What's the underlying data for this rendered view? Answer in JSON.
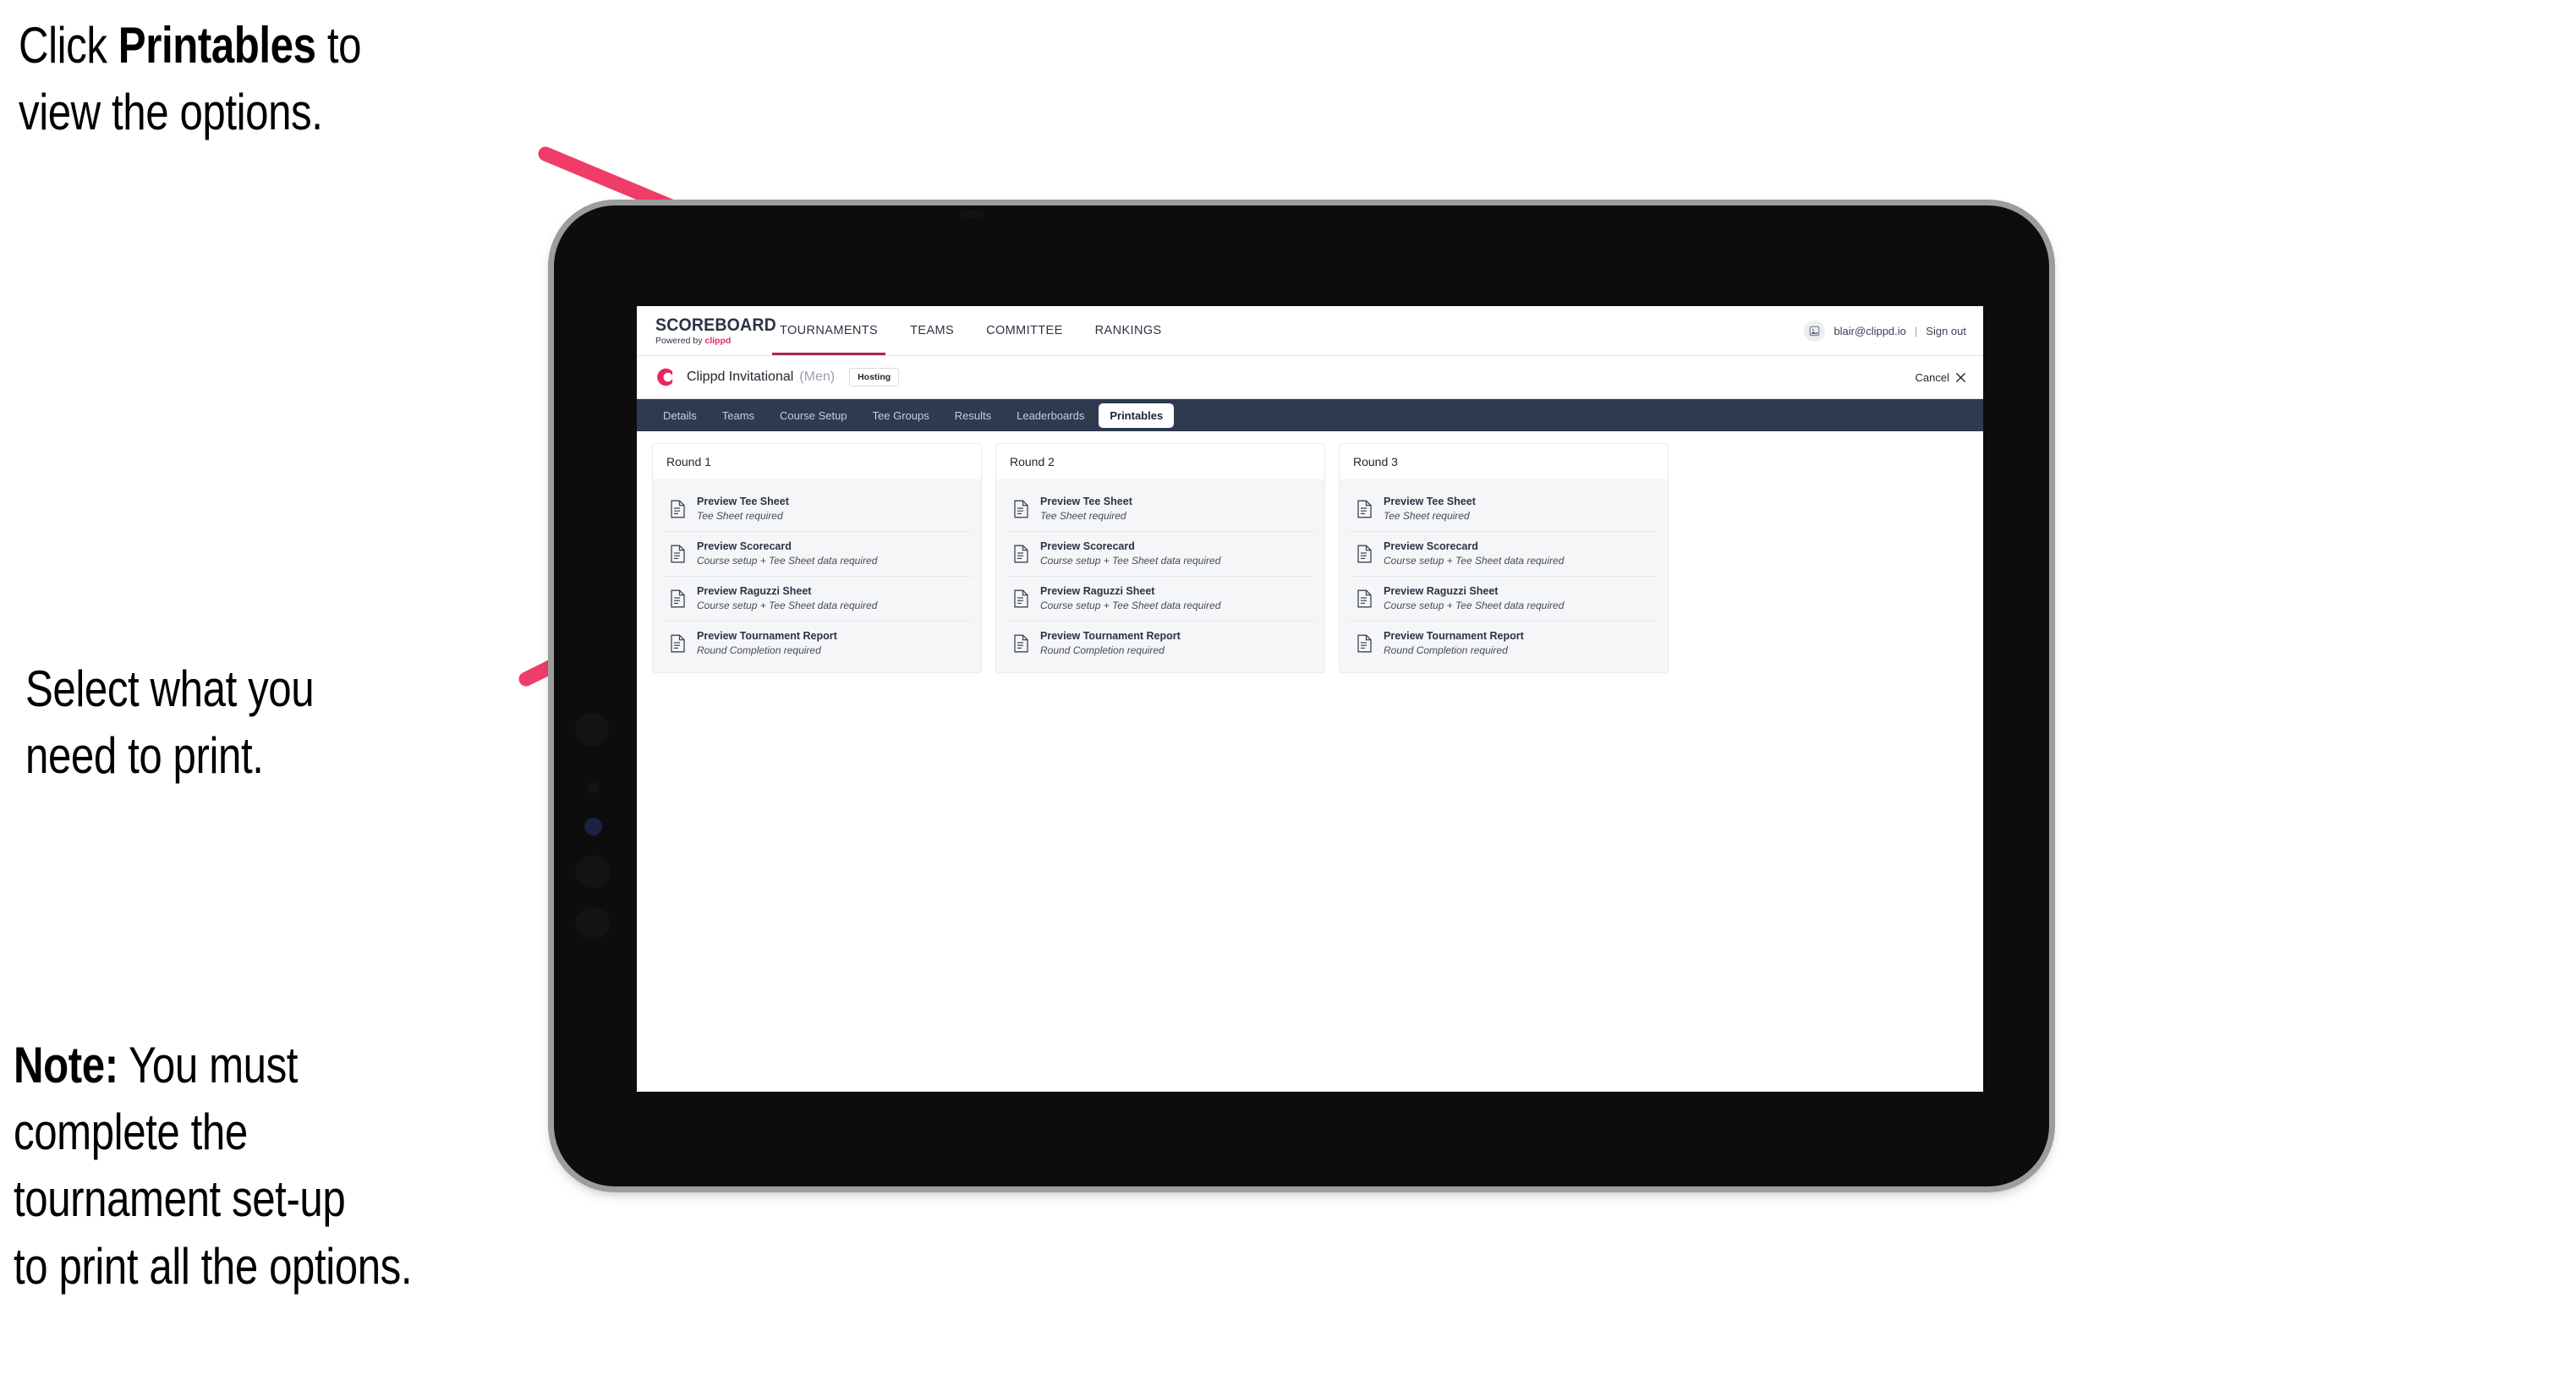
{
  "annotations": {
    "click_printables": "Click **Printables** to\nview the options.",
    "click_printables_pre": "Click ",
    "click_printables_bold": "Printables",
    "click_printables_post": " to\nview the options.",
    "select_print": "Select what you\n need to print.",
    "note_label": "Note:",
    "note_body": " You must\ncomplete the\ntournament set-up\nto print all the options.",
    "arrow_color": "#ef3d68"
  },
  "topbar": {
    "logo_word": "SCOREBOARD",
    "logo_sub_prefix": "Powered by ",
    "logo_sub_brand": "clippd",
    "nav": [
      {
        "label": "TOURNAMENTS",
        "active": true
      },
      {
        "label": "TEAMS",
        "active": false
      },
      {
        "label": "COMMITTEE",
        "active": false
      },
      {
        "label": "RANKINGS",
        "active": false
      }
    ],
    "avatar_icon": "user-avatar-icon",
    "user_email": "blair@clippd.io",
    "separator": "|",
    "sign_out": "Sign out"
  },
  "tournament_header": {
    "brand_icon": "clippd-c-logo-icon",
    "title": "Clippd Invitational",
    "gender": "(Men)",
    "status_chip": "Hosting",
    "cancel_label": "Cancel",
    "cancel_icon": "close-icon"
  },
  "tabs": [
    {
      "label": "Details",
      "active": false
    },
    {
      "label": "Teams",
      "active": false
    },
    {
      "label": "Course Setup",
      "active": false
    },
    {
      "label": "Tee Groups",
      "active": false
    },
    {
      "label": "Results",
      "active": false
    },
    {
      "label": "Leaderboards",
      "active": false
    },
    {
      "label": "Printables",
      "active": true
    }
  ],
  "rounds": [
    {
      "title": "Round 1",
      "items": [
        {
          "title": "Preview Tee Sheet",
          "sub": "Tee Sheet required",
          "icon": "document-icon"
        },
        {
          "title": "Preview Scorecard",
          "sub": "Course setup + Tee Sheet data required",
          "icon": "document-icon"
        },
        {
          "title": "Preview Raguzzi Sheet",
          "sub": "Course setup + Tee Sheet data required",
          "icon": "document-icon"
        },
        {
          "title": "Preview Tournament Report",
          "sub": "Round Completion required",
          "icon": "document-icon"
        }
      ]
    },
    {
      "title": "Round 2",
      "items": [
        {
          "title": "Preview Tee Sheet",
          "sub": "Tee Sheet required",
          "icon": "document-icon"
        },
        {
          "title": "Preview Scorecard",
          "sub": "Course setup + Tee Sheet data required",
          "icon": "document-icon"
        },
        {
          "title": "Preview Raguzzi Sheet",
          "sub": "Course setup + Tee Sheet data required",
          "icon": "document-icon"
        },
        {
          "title": "Preview Tournament Report",
          "sub": "Round Completion required",
          "icon": "document-icon"
        }
      ]
    },
    {
      "title": "Round 3",
      "items": [
        {
          "title": "Preview Tee Sheet",
          "sub": "Tee Sheet required",
          "icon": "document-icon"
        },
        {
          "title": "Preview Scorecard",
          "sub": "Course setup + Tee Sheet data required",
          "icon": "document-icon"
        },
        {
          "title": "Preview Raguzzi Sheet",
          "sub": "Course setup + Tee Sheet data required",
          "icon": "document-icon"
        },
        {
          "title": "Preview Tournament Report",
          "sub": "Round Completion required",
          "icon": "document-icon"
        }
      ]
    }
  ],
  "colors": {
    "tabbar_bg": "#2f3a4f",
    "brand_pink": "#e8265f",
    "nav_underline": "#a6284a",
    "arrow": "#ef3d68",
    "card_bg": "#f5f6f8"
  }
}
